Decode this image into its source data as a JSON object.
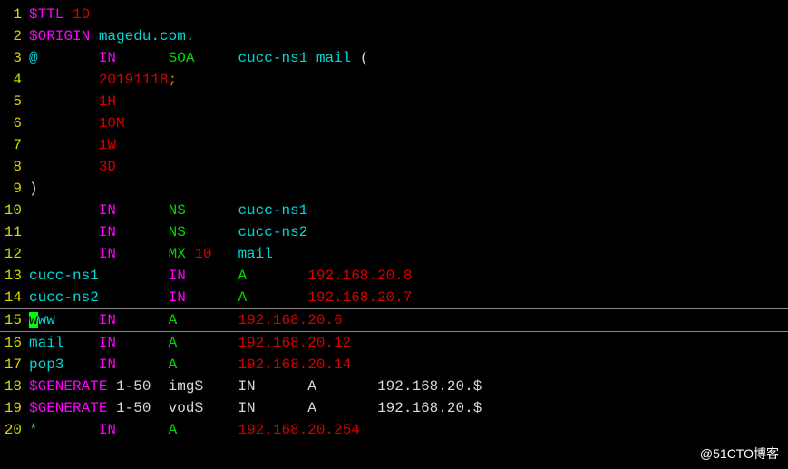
{
  "lines": [
    {
      "num": "1",
      "segments": [
        {
          "cls": "magenta",
          "text": "$TTL"
        },
        {
          "cls": "white",
          "text": " "
        },
        {
          "cls": "red",
          "text": "1D"
        }
      ]
    },
    {
      "num": "2",
      "segments": [
        {
          "cls": "magenta",
          "text": "$ORIGIN"
        },
        {
          "cls": "white",
          "text": " "
        },
        {
          "cls": "cyan",
          "text": "magedu.com."
        }
      ]
    },
    {
      "num": "3",
      "segments": [
        {
          "cls": "cyan",
          "text": "@"
        },
        {
          "cls": "white",
          "text": "       "
        },
        {
          "cls": "magenta",
          "text": "IN"
        },
        {
          "cls": "white",
          "text": "      "
        },
        {
          "cls": "green",
          "text": "SOA"
        },
        {
          "cls": "white",
          "text": "     "
        },
        {
          "cls": "cyan",
          "text": "cucc-ns1 mail"
        },
        {
          "cls": "white",
          "text": " ("
        }
      ]
    },
    {
      "num": "4",
      "segments": [
        {
          "cls": "white",
          "text": "        "
        },
        {
          "cls": "red",
          "text": "20191118"
        },
        {
          "cls": "orange",
          "text": ";"
        }
      ]
    },
    {
      "num": "5",
      "segments": [
        {
          "cls": "white",
          "text": "        "
        },
        {
          "cls": "red",
          "text": "1H"
        }
      ]
    },
    {
      "num": "6",
      "segments": [
        {
          "cls": "white",
          "text": "        "
        },
        {
          "cls": "red",
          "text": "10M"
        }
      ]
    },
    {
      "num": "7",
      "segments": [
        {
          "cls": "white",
          "text": "        "
        },
        {
          "cls": "red",
          "text": "1W"
        }
      ]
    },
    {
      "num": "8",
      "segments": [
        {
          "cls": "white",
          "text": "        "
        },
        {
          "cls": "red",
          "text": "3D"
        }
      ]
    },
    {
      "num": "9",
      "segments": [
        {
          "cls": "white",
          "text": ")"
        }
      ]
    },
    {
      "num": "10",
      "segments": [
        {
          "cls": "white",
          "text": "        "
        },
        {
          "cls": "magenta",
          "text": "IN"
        },
        {
          "cls": "white",
          "text": "      "
        },
        {
          "cls": "green",
          "text": "NS"
        },
        {
          "cls": "white",
          "text": "      "
        },
        {
          "cls": "cyan",
          "text": "cucc-ns1"
        }
      ]
    },
    {
      "num": "11",
      "segments": [
        {
          "cls": "white",
          "text": "        "
        },
        {
          "cls": "magenta",
          "text": "IN"
        },
        {
          "cls": "white",
          "text": "      "
        },
        {
          "cls": "green",
          "text": "NS"
        },
        {
          "cls": "white",
          "text": "      "
        },
        {
          "cls": "cyan",
          "text": "cucc-ns2"
        }
      ]
    },
    {
      "num": "12",
      "segments": [
        {
          "cls": "white",
          "text": "        "
        },
        {
          "cls": "magenta",
          "text": "IN"
        },
        {
          "cls": "white",
          "text": "      "
        },
        {
          "cls": "green",
          "text": "MX"
        },
        {
          "cls": "white",
          "text": " "
        },
        {
          "cls": "red",
          "text": "10"
        },
        {
          "cls": "white",
          "text": "   "
        },
        {
          "cls": "cyan",
          "text": "mail"
        }
      ]
    },
    {
      "num": "13",
      "segments": [
        {
          "cls": "cyan",
          "text": "cucc-ns1"
        },
        {
          "cls": "white",
          "text": "        "
        },
        {
          "cls": "magenta",
          "text": "IN"
        },
        {
          "cls": "white",
          "text": "      "
        },
        {
          "cls": "green",
          "text": "A"
        },
        {
          "cls": "white",
          "text": "       "
        },
        {
          "cls": "red",
          "text": "192.168.20.8"
        }
      ]
    },
    {
      "num": "14",
      "segments": [
        {
          "cls": "cyan",
          "text": "cucc-ns2"
        },
        {
          "cls": "white",
          "text": "        "
        },
        {
          "cls": "magenta",
          "text": "IN"
        },
        {
          "cls": "white",
          "text": "      "
        },
        {
          "cls": "green",
          "text": "A"
        },
        {
          "cls": "white",
          "text": "       "
        },
        {
          "cls": "red",
          "text": "192.168.20.7"
        }
      ]
    },
    {
      "num": "15",
      "cursor": true,
      "segments": [
        {
          "cls": "cyan cursor-char",
          "text": "w"
        },
        {
          "cls": "cyan",
          "text": "ww"
        },
        {
          "cls": "white",
          "text": "     "
        },
        {
          "cls": "magenta",
          "text": "IN"
        },
        {
          "cls": "white",
          "text": "      "
        },
        {
          "cls": "green",
          "text": "A"
        },
        {
          "cls": "white",
          "text": "       "
        },
        {
          "cls": "red",
          "text": "192.168.20.6"
        }
      ]
    },
    {
      "num": "16",
      "segments": [
        {
          "cls": "cyan",
          "text": "mail"
        },
        {
          "cls": "white",
          "text": "    "
        },
        {
          "cls": "magenta",
          "text": "IN"
        },
        {
          "cls": "white",
          "text": "      "
        },
        {
          "cls": "green",
          "text": "A"
        },
        {
          "cls": "white",
          "text": "       "
        },
        {
          "cls": "red",
          "text": "192.168.20.12"
        }
      ]
    },
    {
      "num": "17",
      "segments": [
        {
          "cls": "cyan",
          "text": "pop3"
        },
        {
          "cls": "white",
          "text": "    "
        },
        {
          "cls": "magenta",
          "text": "IN"
        },
        {
          "cls": "white",
          "text": "      "
        },
        {
          "cls": "green",
          "text": "A"
        },
        {
          "cls": "white",
          "text": "       "
        },
        {
          "cls": "red",
          "text": "192.168.20.14"
        }
      ]
    },
    {
      "num": "18",
      "segments": [
        {
          "cls": "magenta",
          "text": "$GENERATE"
        },
        {
          "cls": "white",
          "text": " 1-50  img$    IN      A       192.168.20.$"
        }
      ]
    },
    {
      "num": "19",
      "segments": [
        {
          "cls": "magenta",
          "text": "$GENERATE"
        },
        {
          "cls": "white",
          "text": " 1-50  vod$    IN      A       192.168.20.$"
        }
      ]
    },
    {
      "num": "20",
      "segments": [
        {
          "cls": "cyan",
          "text": "*"
        },
        {
          "cls": "white",
          "text": "       "
        },
        {
          "cls": "magenta",
          "text": "IN"
        },
        {
          "cls": "white",
          "text": "      "
        },
        {
          "cls": "green",
          "text": "A"
        },
        {
          "cls": "white",
          "text": "       "
        },
        {
          "cls": "red",
          "text": "192.168.20.254"
        }
      ]
    }
  ],
  "watermark": "@51CTO博客"
}
